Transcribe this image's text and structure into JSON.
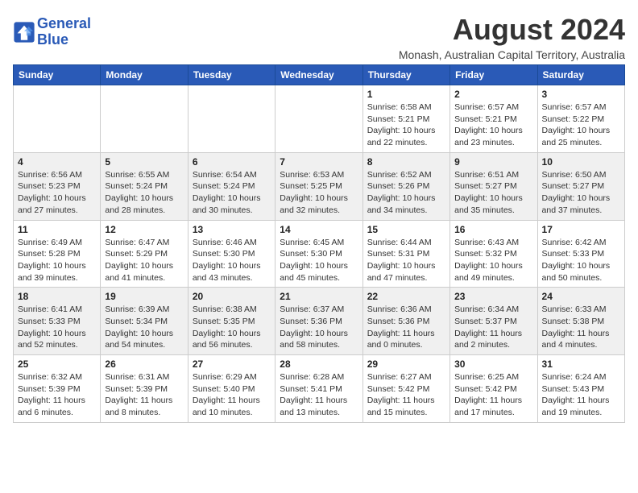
{
  "logo": {
    "line1": "General",
    "line2": "Blue"
  },
  "title": "August 2024",
  "subtitle": "Monash, Australian Capital Territory, Australia",
  "weekdays": [
    "Sunday",
    "Monday",
    "Tuesday",
    "Wednesday",
    "Thursday",
    "Friday",
    "Saturday"
  ],
  "weeks": [
    [
      {
        "day": "",
        "info": ""
      },
      {
        "day": "",
        "info": ""
      },
      {
        "day": "",
        "info": ""
      },
      {
        "day": "",
        "info": ""
      },
      {
        "day": "1",
        "info": "Sunrise: 6:58 AM\nSunset: 5:21 PM\nDaylight: 10 hours\nand 22 minutes."
      },
      {
        "day": "2",
        "info": "Sunrise: 6:57 AM\nSunset: 5:21 PM\nDaylight: 10 hours\nand 23 minutes."
      },
      {
        "day": "3",
        "info": "Sunrise: 6:57 AM\nSunset: 5:22 PM\nDaylight: 10 hours\nand 25 minutes."
      }
    ],
    [
      {
        "day": "4",
        "info": "Sunrise: 6:56 AM\nSunset: 5:23 PM\nDaylight: 10 hours\nand 27 minutes."
      },
      {
        "day": "5",
        "info": "Sunrise: 6:55 AM\nSunset: 5:24 PM\nDaylight: 10 hours\nand 28 minutes."
      },
      {
        "day": "6",
        "info": "Sunrise: 6:54 AM\nSunset: 5:24 PM\nDaylight: 10 hours\nand 30 minutes."
      },
      {
        "day": "7",
        "info": "Sunrise: 6:53 AM\nSunset: 5:25 PM\nDaylight: 10 hours\nand 32 minutes."
      },
      {
        "day": "8",
        "info": "Sunrise: 6:52 AM\nSunset: 5:26 PM\nDaylight: 10 hours\nand 34 minutes."
      },
      {
        "day": "9",
        "info": "Sunrise: 6:51 AM\nSunset: 5:27 PM\nDaylight: 10 hours\nand 35 minutes."
      },
      {
        "day": "10",
        "info": "Sunrise: 6:50 AM\nSunset: 5:27 PM\nDaylight: 10 hours\nand 37 minutes."
      }
    ],
    [
      {
        "day": "11",
        "info": "Sunrise: 6:49 AM\nSunset: 5:28 PM\nDaylight: 10 hours\nand 39 minutes."
      },
      {
        "day": "12",
        "info": "Sunrise: 6:47 AM\nSunset: 5:29 PM\nDaylight: 10 hours\nand 41 minutes."
      },
      {
        "day": "13",
        "info": "Sunrise: 6:46 AM\nSunset: 5:30 PM\nDaylight: 10 hours\nand 43 minutes."
      },
      {
        "day": "14",
        "info": "Sunrise: 6:45 AM\nSunset: 5:30 PM\nDaylight: 10 hours\nand 45 minutes."
      },
      {
        "day": "15",
        "info": "Sunrise: 6:44 AM\nSunset: 5:31 PM\nDaylight: 10 hours\nand 47 minutes."
      },
      {
        "day": "16",
        "info": "Sunrise: 6:43 AM\nSunset: 5:32 PM\nDaylight: 10 hours\nand 49 minutes."
      },
      {
        "day": "17",
        "info": "Sunrise: 6:42 AM\nSunset: 5:33 PM\nDaylight: 10 hours\nand 50 minutes."
      }
    ],
    [
      {
        "day": "18",
        "info": "Sunrise: 6:41 AM\nSunset: 5:33 PM\nDaylight: 10 hours\nand 52 minutes."
      },
      {
        "day": "19",
        "info": "Sunrise: 6:39 AM\nSunset: 5:34 PM\nDaylight: 10 hours\nand 54 minutes."
      },
      {
        "day": "20",
        "info": "Sunrise: 6:38 AM\nSunset: 5:35 PM\nDaylight: 10 hours\nand 56 minutes."
      },
      {
        "day": "21",
        "info": "Sunrise: 6:37 AM\nSunset: 5:36 PM\nDaylight: 10 hours\nand 58 minutes."
      },
      {
        "day": "22",
        "info": "Sunrise: 6:36 AM\nSunset: 5:36 PM\nDaylight: 11 hours\nand 0 minutes."
      },
      {
        "day": "23",
        "info": "Sunrise: 6:34 AM\nSunset: 5:37 PM\nDaylight: 11 hours\nand 2 minutes."
      },
      {
        "day": "24",
        "info": "Sunrise: 6:33 AM\nSunset: 5:38 PM\nDaylight: 11 hours\nand 4 minutes."
      }
    ],
    [
      {
        "day": "25",
        "info": "Sunrise: 6:32 AM\nSunset: 5:39 PM\nDaylight: 11 hours\nand 6 minutes."
      },
      {
        "day": "26",
        "info": "Sunrise: 6:31 AM\nSunset: 5:39 PM\nDaylight: 11 hours\nand 8 minutes."
      },
      {
        "day": "27",
        "info": "Sunrise: 6:29 AM\nSunset: 5:40 PM\nDaylight: 11 hours\nand 10 minutes."
      },
      {
        "day": "28",
        "info": "Sunrise: 6:28 AM\nSunset: 5:41 PM\nDaylight: 11 hours\nand 13 minutes."
      },
      {
        "day": "29",
        "info": "Sunrise: 6:27 AM\nSunset: 5:42 PM\nDaylight: 11 hours\nand 15 minutes."
      },
      {
        "day": "30",
        "info": "Sunrise: 6:25 AM\nSunset: 5:42 PM\nDaylight: 11 hours\nand 17 minutes."
      },
      {
        "day": "31",
        "info": "Sunrise: 6:24 AM\nSunset: 5:43 PM\nDaylight: 11 hours\nand 19 minutes."
      }
    ]
  ]
}
